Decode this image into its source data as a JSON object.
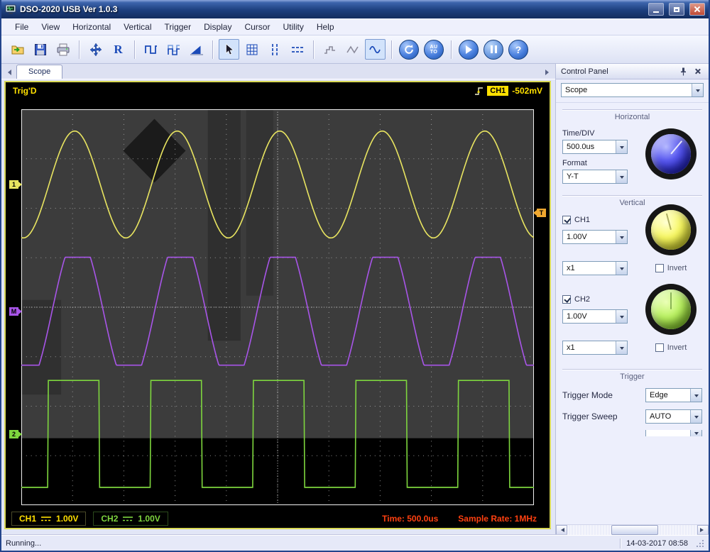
{
  "window": {
    "title": "DSO-2020 USB Ver 1.0.3"
  },
  "menu": {
    "items": [
      "File",
      "View",
      "Horizontal",
      "Vertical",
      "Trigger",
      "Display",
      "Cursor",
      "Utility",
      "Help"
    ]
  },
  "toolbar": {
    "record_label": "R",
    "auto_top": "AU",
    "auto_bottom": "TO",
    "help_label": "?"
  },
  "tabs": {
    "scope_label": "Scope"
  },
  "scope": {
    "trig_status": "Trig'D",
    "trigger_readout": {
      "channel": "CH1",
      "level": "-502mV"
    },
    "markers": {
      "ch1": "1",
      "math": "M",
      "ch2": "2",
      "trigger": "T",
      "trigger_div": 2.1
    },
    "readout": {
      "ch1_label": "CH1",
      "ch1_scale": "1.00V",
      "ch2_label": "CH2",
      "ch2_scale": "1.00V",
      "time": "Time: 500.0us",
      "sample_rate": "Sample Rate: 1MHz"
    },
    "waveforms": {
      "divisions_x": 10,
      "divisions_y": 8,
      "series": [
        {
          "name": "CH1",
          "type": "sine",
          "color": "#e8e460",
          "cycles": 5,
          "center_div": 1.52,
          "amplitude_div": 1.08,
          "phase": -0.27
        },
        {
          "name": "MATH",
          "type": "clipped-sine",
          "color": "#a855e8",
          "cycles": 5,
          "center_div": 4.08,
          "amplitude_div": 1.09,
          "gain": 1.4,
          "phase": -0.3
        },
        {
          "name": "CH2",
          "type": "square",
          "color": "#7ed63e",
          "cycles": 5,
          "center_div": 6.56,
          "amplitude_div": 1.08,
          "phase": -0.26
        }
      ]
    }
  },
  "control_panel": {
    "title": "Control Panel",
    "mode_value": "Scope",
    "horizontal": {
      "section_label": "Horizontal",
      "time_div_label": "Time/DIV",
      "time_div_value": "500.0us",
      "format_label": "Format",
      "format_value": "Y-T"
    },
    "vertical": {
      "section_label": "Vertical",
      "ch1": {
        "label": "CH1",
        "checked": true,
        "scale_value": "1.00V",
        "probe_value": "x1",
        "invert_label": "Invert",
        "invert_checked": false
      },
      "ch2": {
        "label": "CH2",
        "checked": true,
        "scale_value": "1.00V",
        "probe_value": "x1",
        "invert_label": "Invert",
        "invert_checked": false
      }
    },
    "trigger": {
      "section_label": "Trigger",
      "mode_label": "Trigger Mode",
      "mode_value": "Edge",
      "sweep_label": "Trigger Sweep",
      "sweep_value": "AUTO"
    }
  },
  "status": {
    "left": "Running...",
    "datetime": "14-03-2017  08:58"
  }
}
